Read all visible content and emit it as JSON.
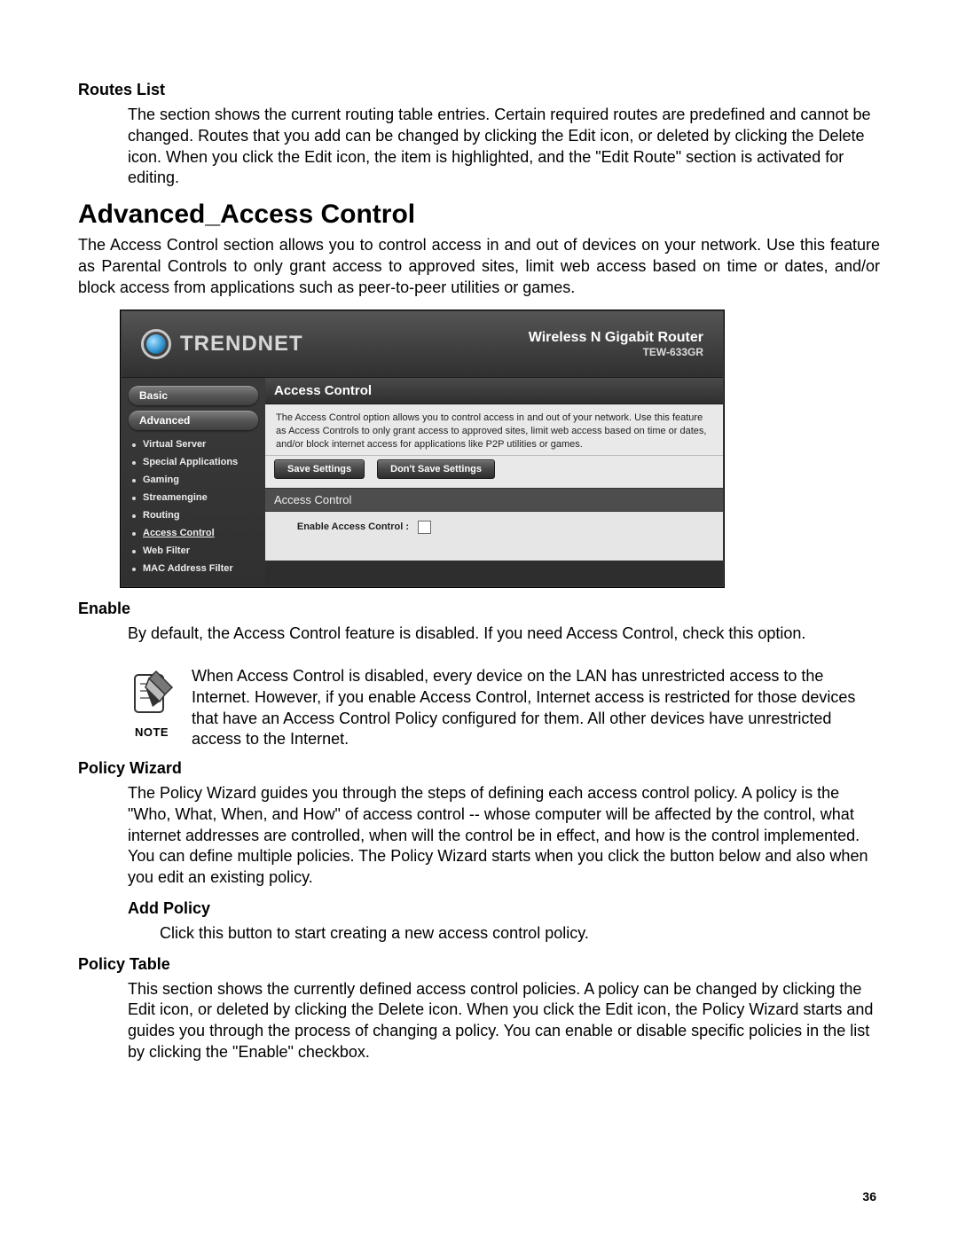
{
  "doc": {
    "routes_heading": "Routes List",
    "routes_body": "The section shows the current routing table entries. Certain required routes are predefined and cannot be changed. Routes that you add can be changed by clicking the Edit icon, or deleted by clicking the Delete icon. When you click the Edit icon, the item is highlighted, and the \"Edit Route\" section is activated for editing.",
    "page_heading": "Advanced_Access Control",
    "intro": "The Access Control section allows you to control access in and out of devices on your network. Use this feature as Parental Controls to only grant access to approved sites, limit web access based on time or dates, and/or block access from applications such as peer-to-peer utilities or games.",
    "enable_heading": "Enable",
    "enable_body": "By default, the Access Control feature is disabled. If you need Access Control, check this option.",
    "note_label": "NOTE",
    "note_body": "When Access Control is disabled, every device on the LAN has unrestricted access to the Internet. However, if you enable Access Control, Internet access is restricted for those devices that have an Access Control Policy configured for them. All other devices have unrestricted access to the Internet.",
    "pw_heading": "Policy Wizard",
    "pw_body": "The Policy Wizard guides you through the steps of defining each access control policy. A policy is the \"Who, What, When, and How\" of access control -- whose computer will be affected by the control, what internet addresses are controlled, when will the control be in effect, and how is the control implemented. You can define multiple policies. The Policy Wizard starts when you click the button below and also when you edit an existing policy.",
    "ap_heading": "Add Policy",
    "ap_body": "Click this button to start creating a new access control policy.",
    "pt_heading": "Policy Table",
    "pt_body": "This section shows the currently defined access control policies. A policy can be changed by clicking the Edit icon, or deleted by clicking the Delete icon. When you click the Edit icon, the Policy Wizard starts and guides you through the process of changing a policy. You can enable or disable specific policies in the list by clicking the \"Enable\" checkbox.",
    "page_number": "36"
  },
  "router": {
    "brand": "TRENDNET",
    "product_main": "Wireless N Gigabit Router",
    "product_sub": "TEW-633GR",
    "nav_basic": "Basic",
    "nav_advanced": "Advanced",
    "sidebar": [
      "Virtual Server",
      "Special Applications",
      "Gaming",
      "Streamengine",
      "Routing",
      "Access Control",
      "Web Filter",
      "MAC Address Filter"
    ],
    "content_title": "Access Control",
    "content_desc": "The Access Control option allows you to control access in and out of your network. Use this feature as Access Controls to only grant access to approved sites, limit web access based on time or dates, and/or block internet access for applications like P2P utilities or games.",
    "btn_save": "Save Settings",
    "btn_dont_save": "Don't Save Settings",
    "panel_head": "Access Control",
    "enable_label": "Enable Access Control  :"
  }
}
